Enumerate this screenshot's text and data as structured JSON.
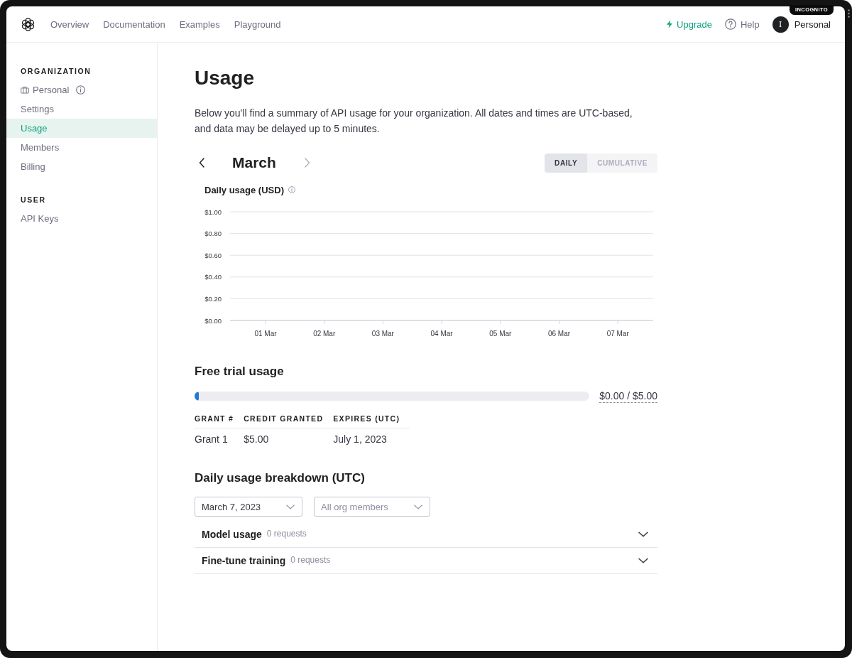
{
  "window": {
    "badge": "INCOGNITO"
  },
  "header": {
    "nav": [
      {
        "label": "Overview"
      },
      {
        "label": "Documentation"
      },
      {
        "label": "Examples"
      },
      {
        "label": "Playground"
      }
    ],
    "upgrade": "Upgrade",
    "help": "Help",
    "account": {
      "initial": "I",
      "name": "Personal"
    }
  },
  "sidebar": {
    "sections": [
      {
        "title": "ORGANIZATION",
        "items": [
          {
            "label": "Personal",
            "kind": "org",
            "selected": false
          },
          {
            "label": "Settings",
            "kind": "link",
            "selected": false
          },
          {
            "label": "Usage",
            "kind": "link",
            "selected": true
          },
          {
            "label": "Members",
            "kind": "link",
            "selected": false
          },
          {
            "label": "Billing",
            "kind": "link",
            "selected": false
          }
        ]
      },
      {
        "title": "USER",
        "items": [
          {
            "label": "API Keys",
            "kind": "link",
            "selected": false
          }
        ]
      }
    ]
  },
  "page": {
    "title": "Usage",
    "description": "Below you'll find a summary of API usage for your organization. All dates and times are UTC-based, and data may be delayed up to 5 minutes."
  },
  "month_nav": {
    "label": "March",
    "previous": {
      "disabled": false
    },
    "next": {
      "disabled": true
    }
  },
  "view_toggle": [
    {
      "label": "DAILY",
      "selected": true
    },
    {
      "label": "CUMULATIVE",
      "selected": false
    }
  ],
  "daily_usage": {
    "chart_data": {
      "type": "bar",
      "title": "Daily usage (USD)",
      "categories": [
        "01 Mar",
        "02 Mar",
        "03 Mar",
        "04 Mar",
        "05 Mar",
        "06 Mar",
        "07 Mar"
      ],
      "values": [
        0,
        0,
        0,
        0,
        0,
        0,
        0
      ],
      "ylim": [
        0,
        1
      ],
      "yticks": [
        {
          "value": 0,
          "label": "$0.00"
        },
        {
          "value": 0.2,
          "label": "$0.20"
        },
        {
          "value": 0.4,
          "label": "$0.40"
        },
        {
          "value": 0.6,
          "label": "$0.60"
        },
        {
          "value": 0.8,
          "label": "$0.80"
        },
        {
          "value": 1,
          "label": "$1.00"
        }
      ],
      "grid": true
    }
  },
  "free_trial": {
    "title": "Free trial usage",
    "level": 0.01,
    "reading": "$0.00 / $5.00",
    "columns": [
      "GRANT #",
      "CREDIT GRANTED",
      "EXPIRES (UTC)"
    ],
    "rows": [
      [
        "Grant 1",
        "$5.00",
        "July 1, 2023"
      ]
    ]
  },
  "breakdown": {
    "title": "Daily usage breakdown (UTC)",
    "filters": [
      {
        "value": "March 7, 2023"
      },
      {
        "placeholder": "All org members"
      }
    ],
    "sections": [
      {
        "title": "Model usage",
        "count": "0 requests",
        "expanded": false
      },
      {
        "title": "Fine-tune training",
        "count": "0 requests",
        "expanded": false
      }
    ]
  }
}
